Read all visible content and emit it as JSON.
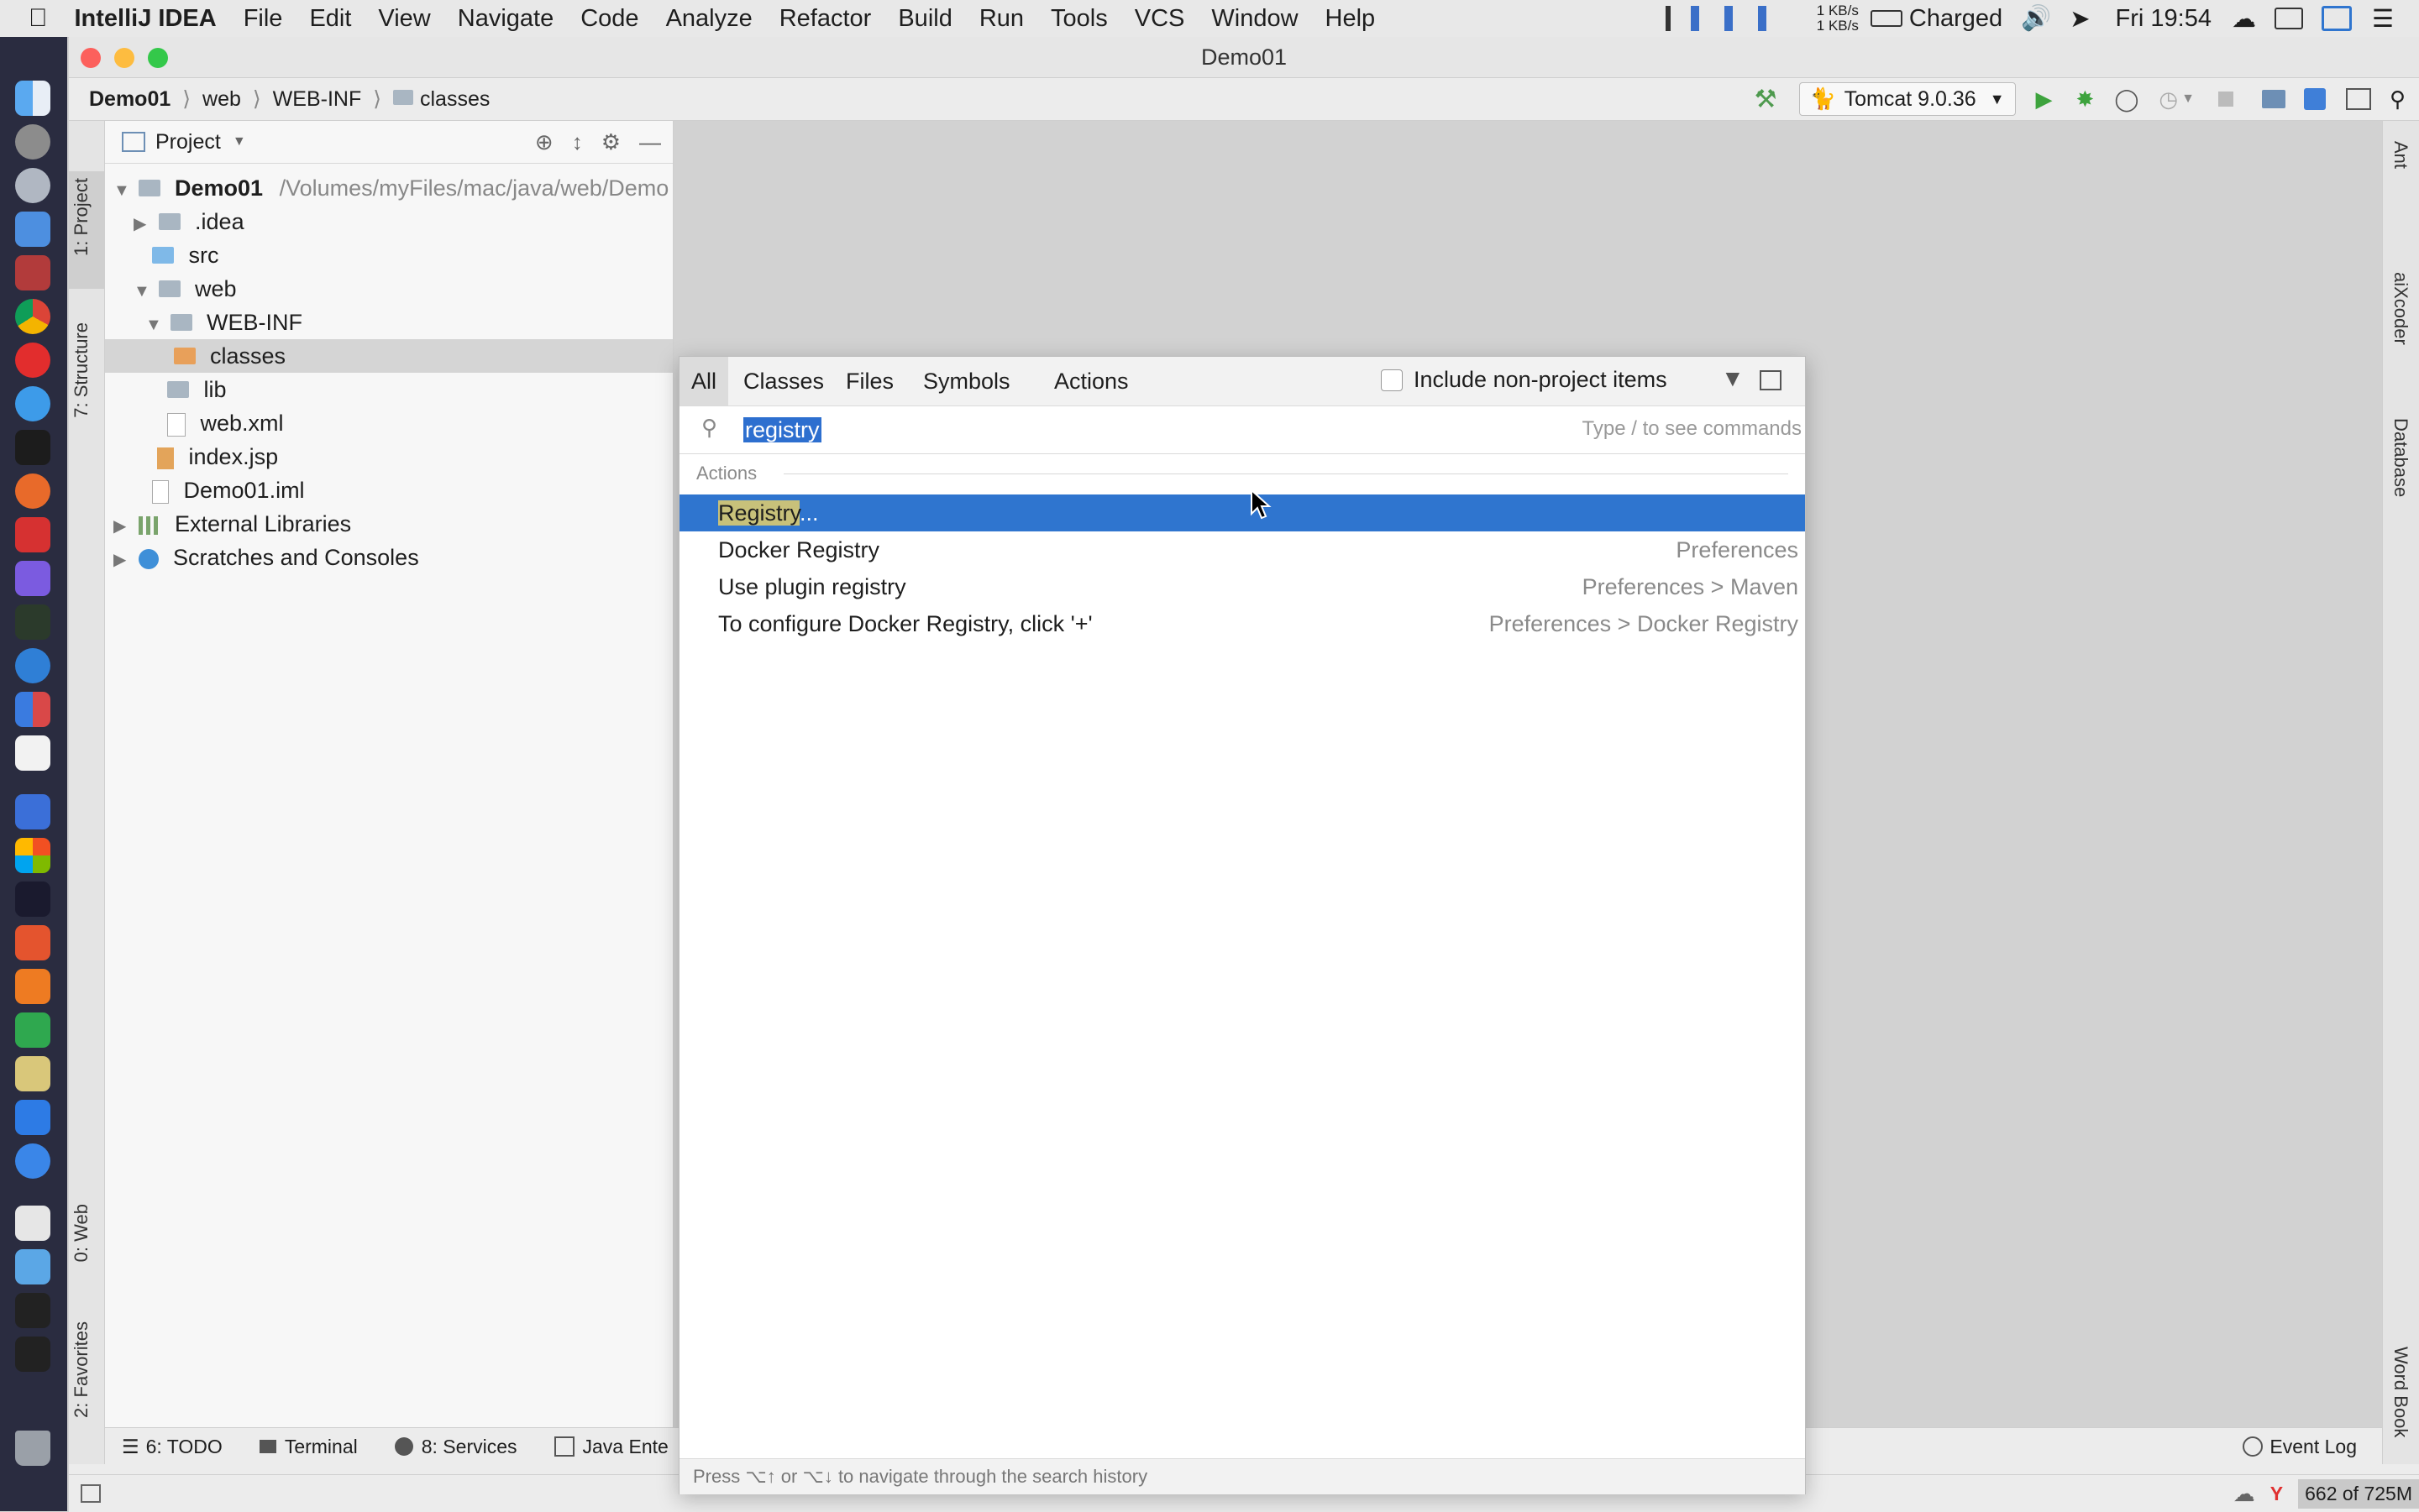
{
  "menubar": {
    "app_name": "IntelliJ IDEA",
    "items": [
      "File",
      "Edit",
      "View",
      "Navigate",
      "Code",
      "Analyze",
      "Refactor",
      "Build",
      "Run",
      "Tools",
      "VCS",
      "Window",
      "Help"
    ],
    "net_up": "1 KB/s",
    "net_down": "1 KB/s",
    "battery": "Charged",
    "clock": "Fri 19:54"
  },
  "window": {
    "title": "Demo01"
  },
  "breadcrumb": [
    "Demo01",
    "web",
    "WEB-INF",
    "classes"
  ],
  "run_config": {
    "label": "Tomcat 9.0.36"
  },
  "tool_strips": {
    "left": [
      "1: Project",
      "7: Structure",
      "0: Web",
      "2: Favorites"
    ],
    "right": [
      "Ant",
      "aiXcoder",
      "Database",
      "Word Book"
    ]
  },
  "project_panel": {
    "view_label": "Project",
    "root_name": "Demo01",
    "root_path": "/Volumes/myFiles/mac/java/web/Demo",
    "items": [
      {
        "label": ".idea"
      },
      {
        "label": "src"
      },
      {
        "label": "web"
      },
      {
        "label": "WEB-INF"
      },
      {
        "label": "classes"
      },
      {
        "label": "lib"
      },
      {
        "label": "web.xml"
      },
      {
        "label": "index.jsp"
      },
      {
        "label": "Demo01.iml"
      },
      {
        "label": "External Libraries"
      },
      {
        "label": "Scratches and Consoles"
      }
    ]
  },
  "bottom_tabs": [
    "6: TODO",
    "Terminal",
    "8: Services",
    "Java Ente"
  ],
  "event_log": "Event Log",
  "memory": "662 of 725M",
  "search_popup": {
    "tabs": [
      "All",
      "Classes",
      "Files",
      "Symbols",
      "Actions"
    ],
    "active_tab": "All",
    "include_label": "Include non-project items",
    "query": "registry",
    "hint": "Type / to see commands",
    "section": "Actions",
    "results": [
      {
        "name_match": "Registry",
        "name_rest": "...",
        "location": ""
      },
      {
        "name": "Docker Registry",
        "location": "Preferences"
      },
      {
        "name": "Use plugin registry",
        "location": "Preferences > Maven"
      },
      {
        "name": "To configure Docker Registry, click '+'",
        "location": "Preferences > Docker Registry"
      }
    ],
    "footer": "Press ⌥↑ or ⌥↓ to navigate through the search history"
  },
  "colors": {
    "selection": "#2f75cf",
    "match_highlight": "#c8c17a",
    "dock_bg": "#2a2c40"
  }
}
